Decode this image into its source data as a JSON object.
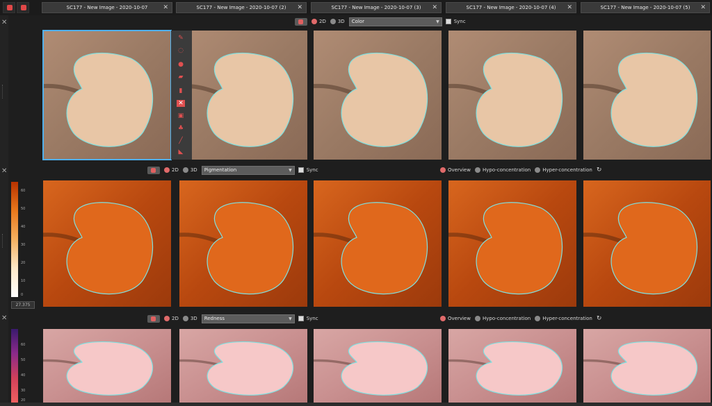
{
  "tabs": [
    {
      "label": "SC177 - New Image - 2020-10-07"
    },
    {
      "label": "SC177 - New Image - 2020-10-07 (2)"
    },
    {
      "label": "SC177 - New Image - 2020-10-07 (3)"
    },
    {
      "label": "SC177 - New Image - 2020-10-07 (4)"
    },
    {
      "label": "SC177 - New Image - 2020-10-07 (5)"
    }
  ],
  "tab_close": "✕",
  "row1": {
    "mode_2d": "2D",
    "mode_3d": "3D",
    "select": "Color",
    "sync": "Sync"
  },
  "row2": {
    "mode_2d": "2D",
    "mode_3d": "3D",
    "select": "Pigmentation",
    "sync": "Sync",
    "overview": "Overview",
    "hypo": "Hypo-concentration",
    "hyper": "Hyper-concentration"
  },
  "row3": {
    "mode_2d": "2D",
    "mode_3d": "3D",
    "select": "Redness",
    "sync": "Sync",
    "overview": "Overview",
    "hypo": "Hypo-concentration",
    "hyper": "Hyper-concentration"
  },
  "pigment_scale": {
    "ticks": [
      "60",
      "50",
      "40",
      "30",
      "20",
      "10",
      "0"
    ],
    "value": "27.375"
  },
  "redness_scale": {
    "ticks": [
      "60",
      "50",
      "40",
      "30",
      "20"
    ]
  },
  "colors": {
    "selection": "#4fb1ee",
    "accent": "#e06060",
    "outline": "#7ee0e0"
  }
}
